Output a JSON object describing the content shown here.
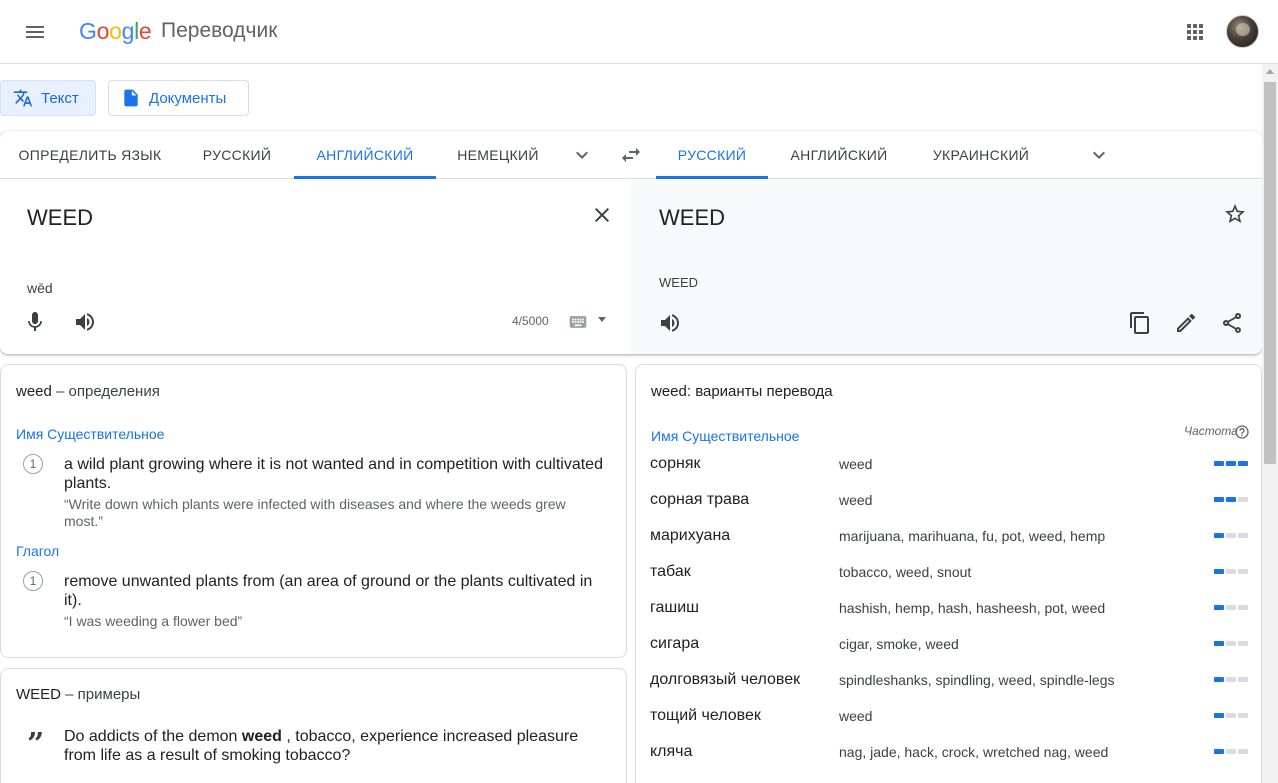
{
  "header": {
    "logo_letters": [
      "G",
      "o",
      "o",
      "g",
      "l",
      "e"
    ],
    "product_name": "Переводчик"
  },
  "modes": {
    "text_label": "Текст",
    "documents_label": "Документы"
  },
  "source_langs": [
    "ОПРЕДЕЛИТЬ ЯЗЫК",
    "РУССКИЙ",
    "АНГЛИЙСКИЙ",
    "НЕМЕЦКИЙ"
  ],
  "target_langs": [
    "РУССКИЙ",
    "АНГЛИЙСКИЙ",
    "УКРАИНСКИЙ"
  ],
  "source": {
    "text": "WEED",
    "transliteration": "wēd",
    "char_count": "4/5000"
  },
  "target": {
    "text": "WEED",
    "transliteration": "WEED"
  },
  "definitions": {
    "title_word": "weed",
    "title_rest": " – определения",
    "noun_label": "Имя Существительное",
    "noun_num": "1",
    "noun_def": "a wild plant growing where it is not wanted and in competition with cultivated plants.",
    "noun_example": "“Write down which plants were infected with diseases and where the weeds grew most.”",
    "verb_label": "Глагол",
    "verb_num": "1",
    "verb_def": "remove unwanted plants from (an area of ground or the plants cultivated in it).",
    "verb_example": "“I was weeding a flower bed”"
  },
  "examples": {
    "title_word": "WEED",
    "title_rest": " – примеры",
    "text_before": "Do addicts of the demon ",
    "text_bold": "weed",
    "text_after": " , tobacco, experience increased pleasure from life as a result of smoking tobacco?"
  },
  "translations": {
    "title": "weed: варианты перевода",
    "pos_label": "Имя Существительное",
    "frequency_label": "Частота",
    "rows": [
      {
        "word": "сорняк",
        "back": "weed",
        "freq": 3
      },
      {
        "word": "сорная трава",
        "back": "weed",
        "freq": 2
      },
      {
        "word": "марихуана",
        "back": "marijuana, marihuana, fu, pot, weed, hemp",
        "freq": 1
      },
      {
        "word": "табак",
        "back": "tobacco, weed, snout",
        "freq": 1
      },
      {
        "word": "гашиш",
        "back": "hashish, hemp, hash, hasheesh, pot, weed",
        "freq": 1
      },
      {
        "word": "сигара",
        "back": "cigar, smoke, weed",
        "freq": 1
      },
      {
        "word": "долговязый человек",
        "back": "spindleshanks, spindling, weed, spindle-legs",
        "freq": 1
      },
      {
        "word": "тощий человек",
        "back": "weed",
        "freq": 1
      },
      {
        "word": "кляча",
        "back": "nag, jade, hack, crock, wretched nag, weed",
        "freq": 1
      }
    ]
  },
  "colors": {
    "accent": "#1a73e8",
    "bar_off": "#dadce0"
  }
}
